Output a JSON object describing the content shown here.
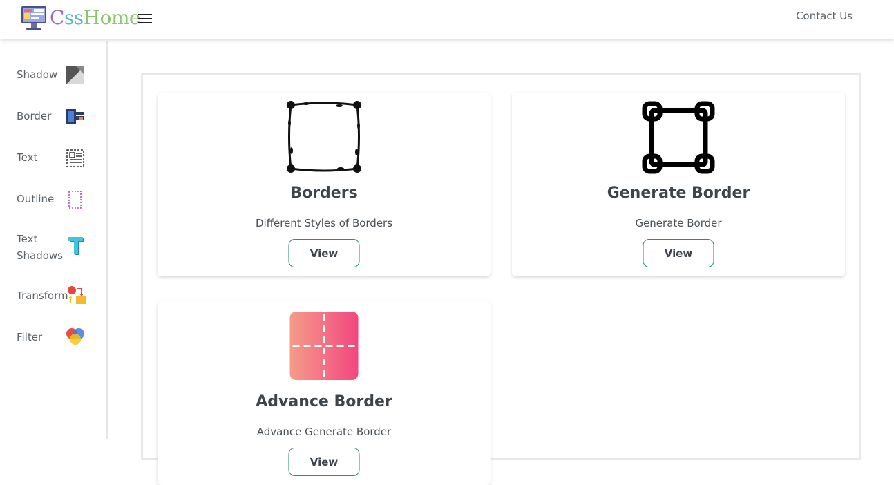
{
  "header": {
    "logo_text": [
      "C",
      "ss",
      "Home"
    ],
    "logo_colors": [
      "#9b6bcc",
      "#5fb7c9",
      "#8cc56a"
    ],
    "menu_icon": "hamburger-menu-icon",
    "contact_label": "Contact Us"
  },
  "sidebar": {
    "items": [
      {
        "label": "Shadow",
        "icon": "shadow-icon"
      },
      {
        "label": "Border",
        "icon": "border-icon"
      },
      {
        "label": "Text",
        "icon": "text-document-icon"
      },
      {
        "label": "Outline",
        "icon": "outline-icon"
      },
      {
        "label": "Text Shadows",
        "icon": "letter-t-icon"
      },
      {
        "label": "Transform",
        "icon": "transform-icon"
      },
      {
        "label": "Filter",
        "icon": "filter-icon"
      }
    ]
  },
  "cards": [
    {
      "title": "Borders",
      "description": "Different Styles of Borders",
      "button": "View",
      "icon": "vine-border-icon"
    },
    {
      "title": "Generate Border",
      "description": "Generate Border",
      "button": "View",
      "icon": "rounded-square-border-icon"
    },
    {
      "title": "Advance Border",
      "description": "Advance Generate Border",
      "button": "View",
      "icon": "gradient-dashed-border-icon"
    }
  ],
  "colors": {
    "button_border": "#2a8a72",
    "gradient_start": "#f59c8a",
    "gradient_end": "#f2477e"
  }
}
